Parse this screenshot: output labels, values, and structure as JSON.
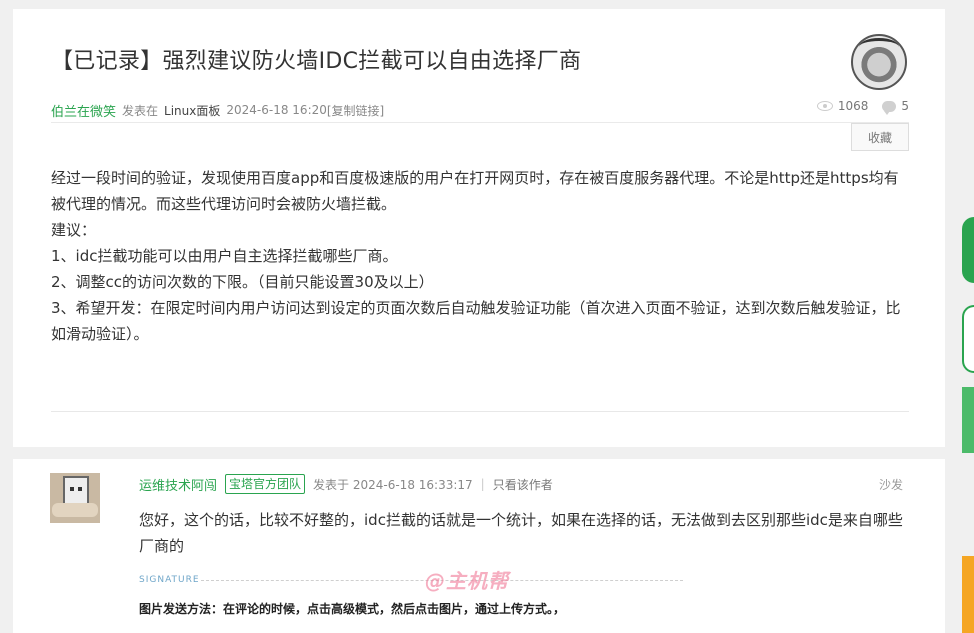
{
  "post": {
    "title": "【已记录】强烈建议防火墙IDC拦截可以自由选择厂商",
    "author": "伯兰在微笑",
    "posted_in_label": "发表在",
    "forum": "Linux面板",
    "date": "2024-6-18 16:20",
    "copy_link": "[复制链接]",
    "views": "1068",
    "replies": "5",
    "favorite_label": "收藏",
    "body": [
      "经过一段时间的验证，发现使用百度app和百度极速版的用户在打开网页时，存在被百度服务器代理。不论是http还是https均有被代理的情况。而这些代理访问时会被防火墙拦截。",
      "建议：",
      "1、idc拦截功能可以由用户自主选择拦截哪些厂商。",
      "2、调整cc的访问次数的下限。（目前只能设置30及以上）",
      "3、希望开发：在限定时间内用户访问达到设定的页面次数后自动触发验证功能（首次进入页面不验证，达到次数后触发验证，比如滑动验证）。"
    ]
  },
  "reply": {
    "author": "运维技术阿闯",
    "badge": "宝塔官方团队",
    "posted": "发表于 2024-6-18 16:33:17",
    "separator": "|",
    "author_only": "只看该作者",
    "floor": "沙发",
    "content": "您好，这个的话，比较不好整的，idc拦截的话就是一个统计，如果在选择的话，无法做到去区别那些idc是来自哪些厂商的",
    "signature_label": "SIGNATURE",
    "signature": "图片发送方法：在评论的时候，点击高级模式，然后点击图片，通过上传方式。，",
    "watermark": "@主机帮"
  },
  "colors": {
    "brand_green": "#2aa44f",
    "side_orange": "#f5a623"
  }
}
